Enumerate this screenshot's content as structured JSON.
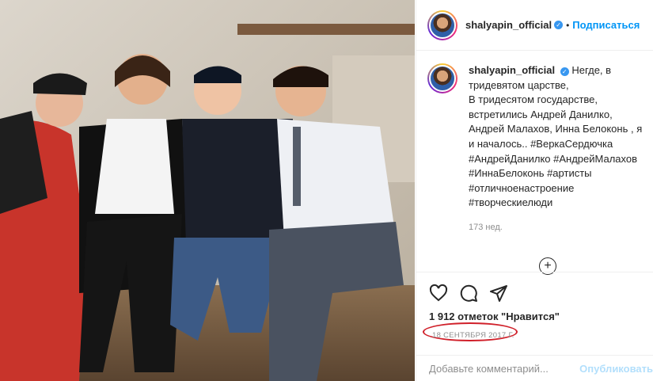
{
  "photo": {
    "alt": "Post photo"
  },
  "header": {
    "username": "shalyapin_official",
    "verified_icon": "verified-badge-icon",
    "separator": "•",
    "follow_label": "Подписаться"
  },
  "caption": {
    "username": "shalyapin_official",
    "text": "Негде, в\nтридевятом царстве,\nВ тридесятом государстве,\nвстретились Андрей Данилко,\nАндрей Малахов, Инна Белоконь , я\nи началось.. #ВеркаСердючка\n#АндрейДанилко #АндрейМалахов\n#ИннаБелоконь #артисты\n#отличноенастроение\n#творческиелюди",
    "time": "173 нед."
  },
  "load_more": {
    "icon": "plus-circle-icon",
    "symbol": "+"
  },
  "actions": {
    "like_icon": "heart-icon",
    "comment_icon": "comment-icon",
    "share_icon": "share-icon"
  },
  "likes": "1 912 отметок \"Нравится\"",
  "date": "18 СЕНТЯБРЯ 2017 Г.",
  "comment_box": {
    "placeholder": "Добавьте комментарий...",
    "publish_label": "Опубликовать"
  },
  "colors": {
    "accent": "#0095f6",
    "verified": "#3897f0",
    "annotation_red": "#d0202a"
  }
}
